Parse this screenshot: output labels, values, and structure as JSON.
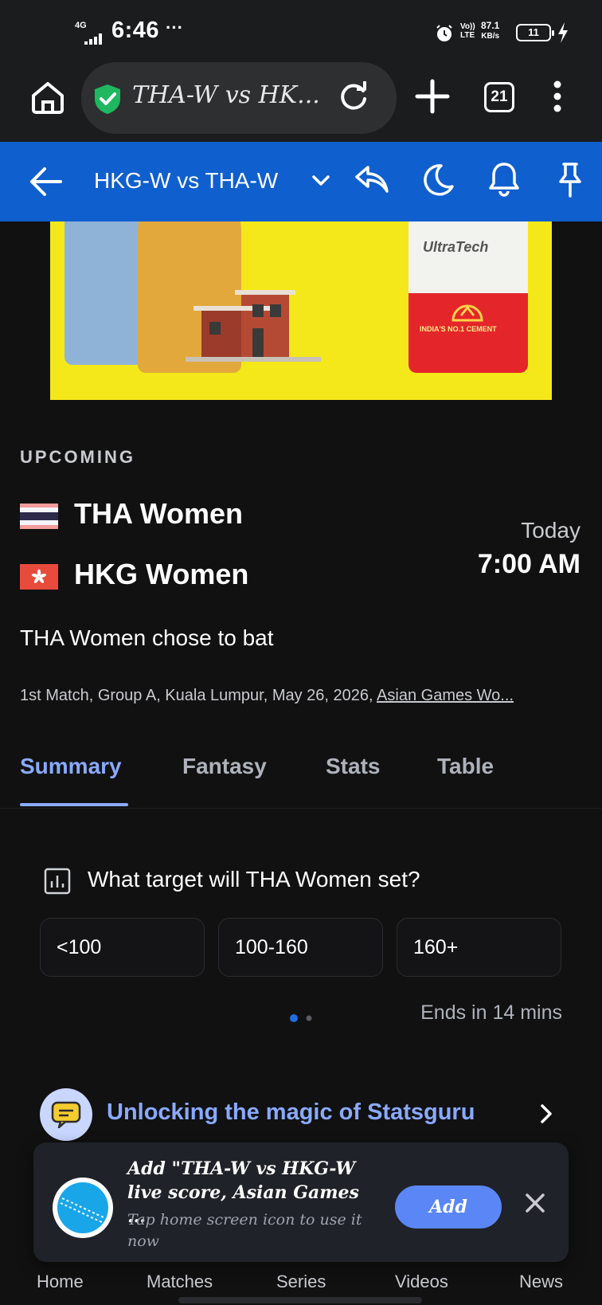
{
  "status_bar": {
    "network": "4G",
    "time": "6:46",
    "more": "···",
    "volte_top": "Vo))",
    "volte_bottom": "LTE",
    "speed_value": "87.1",
    "speed_unit": "KB/s",
    "battery": "11",
    "icons": [
      "signal-icon",
      "alarm-icon",
      "battery-icon",
      "charging-icon"
    ]
  },
  "browser": {
    "url_title": "THA-W vs HK...",
    "tab_count": "21",
    "icons": [
      "home-icon",
      "shield-check-icon",
      "reload-icon",
      "plus-icon",
      "tabs-icon",
      "more-vert-icon"
    ],
    "shield_color": "#1fb860"
  },
  "app_header": {
    "title": "HKG-W vs THA-W",
    "icons": [
      "back-arrow-icon",
      "chevron-down-icon",
      "share-icon",
      "moon-icon",
      "bell-icon",
      "pin-icon"
    ],
    "color": "#0f5fcf"
  },
  "ad": {
    "brand": "UltraTech",
    "tagline": "INDIA'S NO.1 CEMENT"
  },
  "match": {
    "status": "UPCOMING",
    "team1": "THA Women",
    "team2": "HKG Women",
    "day": "Today",
    "time": "7:00 AM",
    "toss": "THA Women chose to bat",
    "description": "1st Match, Group A, Kuala Lumpur, May 26, 2026, ",
    "series": "Asian Games Wo..."
  },
  "tabs": [
    {
      "label": "Summary",
      "active": true
    },
    {
      "label": "Fantasy",
      "active": false
    },
    {
      "label": "Stats",
      "active": false
    },
    {
      "label": "Table",
      "active": false
    }
  ],
  "poll": {
    "question": "What target will THA Women set?",
    "options": [
      "<100",
      "100-160",
      "160+"
    ],
    "ends": "Ends in 14 mins"
  },
  "promo": {
    "text": "Unlocking the magic of Statsguru"
  },
  "bottom_nav": [
    "Home",
    "Matches",
    "Series",
    "Videos",
    "News"
  ],
  "a2hs": {
    "title": "Add \"THA-W vs HKG-W live score, Asian Games ...",
    "subtitle": "Tap home screen icon to use it now",
    "add_label": "Add"
  },
  "colors": {
    "accent": "#8aa9ff",
    "background": "#111111",
    "add_button": "#5b86f6"
  }
}
